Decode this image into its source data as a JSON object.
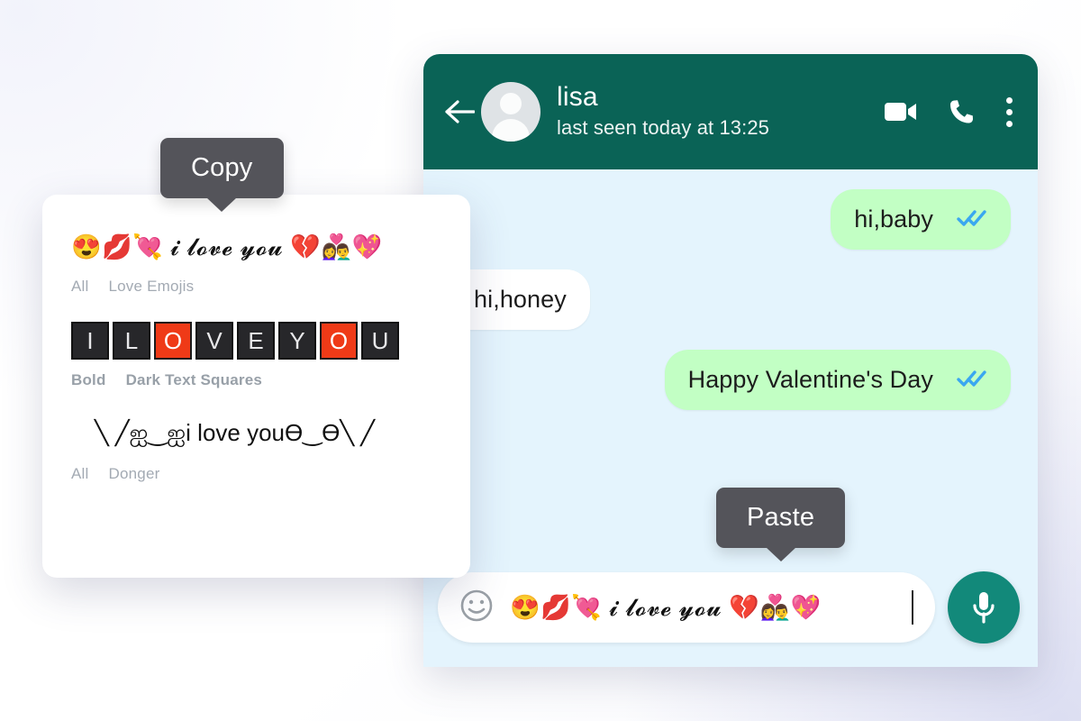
{
  "colors": {
    "header_teal": "#0a6356",
    "mic_teal": "#12897a",
    "chat_bg": "#e4f4fd",
    "outgoing_bubble": "#c2ffc4",
    "incoming_bubble": "#ffffff",
    "tick_blue": "#3aa7f0",
    "tooltip_gray": "#54545a",
    "square_dark": "#27272a",
    "square_red": "#ef3a17",
    "tag_gray": "#a3aab3"
  },
  "chat": {
    "header": {
      "back_icon": "arrow-left-icon",
      "avatar": "contact-avatar",
      "name": "lisa",
      "status": "last seen today at 13:25",
      "video_icon": "video-camera-icon",
      "call_icon": "phone-icon",
      "menu_icon": "more-vertical-icon"
    },
    "messages": [
      {
        "text": "hi,baby",
        "direction": "out",
        "status_icon": "double-check-icon"
      },
      {
        "text": "hi,honey",
        "direction": "in",
        "status_icon": ""
      },
      {
        "text": "Happy Valentine's Day",
        "direction": "out",
        "status_icon": "double-check-icon"
      }
    ],
    "input": {
      "emoji_icon": "smiley-face-icon",
      "value": "😍💋💘 𝓲 𝓵𝓸𝓿𝓮 𝔂𝓸𝓾 💔👩‍❤️‍👨💖",
      "placeholder": "Type a message",
      "mic_icon": "microphone-icon"
    }
  },
  "picker": {
    "entries": [
      {
        "art": "😍💋💘 𝓲 𝓵𝓸𝓿𝓮 𝔂𝓸𝓾 💔👩‍❤️‍👨💖",
        "type": "text",
        "tags": [
          "All",
          "Love Emojis"
        ]
      },
      {
        "type": "squares",
        "letters": [
          {
            "char": "I",
            "highlight": false
          },
          {
            "char": "L",
            "highlight": false
          },
          {
            "char": "O",
            "highlight": true
          },
          {
            "char": "V",
            "highlight": false
          },
          {
            "char": "E",
            "highlight": false
          },
          {
            "char": "Y",
            "highlight": false
          },
          {
            "char": "O",
            "highlight": true
          },
          {
            "char": "U",
            "highlight": false
          }
        ],
        "tags": [
          "Bold",
          "Dark Text Squares"
        ]
      },
      {
        "art": "╲ ╱ஐ‿ஐi love youӨ‿Ө╲ ╱",
        "type": "text",
        "tags": [
          "All",
          "Donger"
        ]
      }
    ]
  },
  "tooltips": {
    "copy": "Copy",
    "paste": "Paste"
  }
}
